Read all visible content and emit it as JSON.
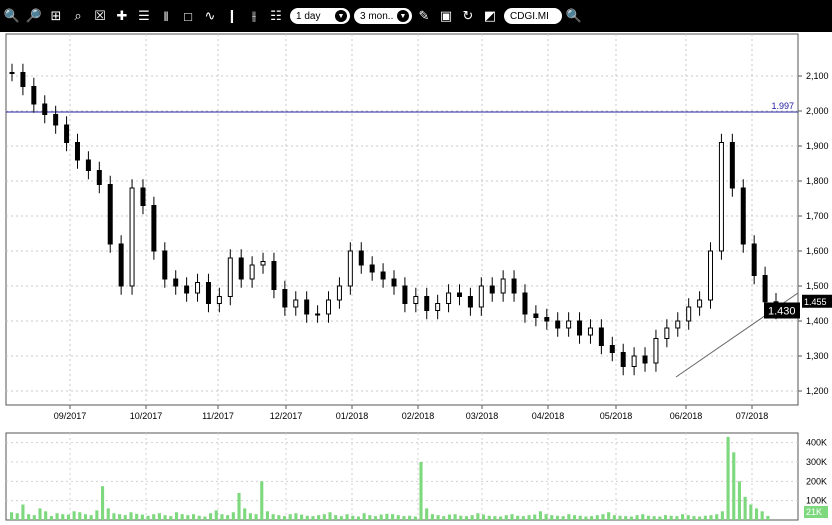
{
  "toolbar": {
    "interval": "1 day",
    "range": "3 mon..",
    "symbol": "CDGI.MI",
    "icons": [
      "zoom-in-icon",
      "zoom-out-icon",
      "zoom-fit-icon",
      "zoom-box-icon",
      "zoom-reset-icon",
      "crosshair-icon",
      "list-icon",
      "bars-icon",
      "rectangle-icon",
      "line-chart-icon",
      "candlestick-icon",
      "ohlc-icon",
      "indicators-icon",
      "interval-dropdown",
      "range-dropdown",
      "draw-icon",
      "save-icon",
      "refresh-icon",
      "color-icon",
      "symbol-field",
      "search-icon"
    ]
  },
  "chart_data": [
    {
      "type": "candlestick",
      "title": "",
      "x_labels": [
        "09/2017",
        "10/2017",
        "11/2017",
        "12/2017",
        "01/2018",
        "02/2018",
        "03/2018",
        "04/2018",
        "05/2018",
        "06/2018",
        "07/2018"
      ],
      "y_ticks": [
        1.2,
        1.3,
        1.4,
        1.5,
        1.6,
        1.7,
        1.8,
        1.9,
        2.0,
        2.1
      ],
      "y_tick_labels": [
        "1,200",
        "1,300",
        "1,400",
        "1,500",
        "1,600",
        "1,700",
        "1,800",
        "1,900",
        "2,000",
        "2,100"
      ],
      "ylim": [
        1.16,
        2.22
      ],
      "grid": true,
      "horizontal_line": {
        "value": 1.997,
        "label": "1.997",
        "color": "#2020a0"
      },
      "trend_line": {
        "from": {
          "date": "2018-06-01",
          "value": 1.24
        },
        "to": {
          "date": "2018-07-31",
          "value": 1.48
        }
      },
      "last_price": {
        "value": 1.43,
        "label": "1.430"
      },
      "previous_price": {
        "value": 1.455,
        "label": "1.455"
      },
      "series": [
        {
          "date": "2017-08-21",
          "value": 2.11
        },
        {
          "date": "2017-08-28",
          "value": 2.07
        },
        {
          "date": "2017-09-04",
          "value": 2.02
        },
        {
          "date": "2017-09-11",
          "value": 1.99
        },
        {
          "date": "2017-09-18",
          "value": 1.96
        },
        {
          "date": "2017-09-25",
          "value": 1.91
        },
        {
          "date": "2017-10-02",
          "value": 1.86
        },
        {
          "date": "2017-10-09",
          "value": 1.83
        },
        {
          "date": "2017-10-16",
          "value": 1.79
        },
        {
          "date": "2017-10-23",
          "value": 1.62
        },
        {
          "date": "2017-10-30",
          "value": 1.5
        },
        {
          "date": "2017-11-06",
          "value": 1.78
        },
        {
          "date": "2017-11-13",
          "value": 1.73
        },
        {
          "date": "2017-11-20",
          "value": 1.6
        },
        {
          "date": "2017-11-27",
          "value": 1.52
        },
        {
          "date": "2017-12-04",
          "value": 1.5
        },
        {
          "date": "2017-12-11",
          "value": 1.48
        },
        {
          "date": "2017-12-18",
          "value": 1.51
        },
        {
          "date": "2017-12-25",
          "value": 1.45
        },
        {
          "date": "2018-01-01",
          "value": 1.47
        },
        {
          "date": "2018-01-08",
          "value": 1.58
        },
        {
          "date": "2018-01-15",
          "value": 1.52
        },
        {
          "date": "2018-01-22",
          "value": 1.56
        },
        {
          "date": "2018-01-29",
          "value": 1.57
        },
        {
          "date": "2018-02-05",
          "value": 1.49
        },
        {
          "date": "2018-02-12",
          "value": 1.44
        },
        {
          "date": "2018-02-19",
          "value": 1.46
        },
        {
          "date": "2018-02-26",
          "value": 1.42
        },
        {
          "date": "2018-03-05",
          "value": 1.42
        },
        {
          "date": "2018-03-12",
          "value": 1.46
        },
        {
          "date": "2018-03-19",
          "value": 1.5
        },
        {
          "date": "2018-03-26",
          "value": 1.6
        },
        {
          "date": "2018-04-02",
          "value": 1.56
        },
        {
          "date": "2018-04-09",
          "value": 1.54
        },
        {
          "date": "2018-04-16",
          "value": 1.52
        },
        {
          "date": "2018-04-23",
          "value": 1.5
        },
        {
          "date": "2018-04-30",
          "value": 1.45
        },
        {
          "date": "2018-05-07",
          "value": 1.47
        },
        {
          "date": "2018-05-14",
          "value": 1.43
        },
        {
          "date": "2018-05-21",
          "value": 1.45
        },
        {
          "date": "2018-05-28",
          "value": 1.48
        },
        {
          "date": "2018-06-04",
          "value": 1.47
        },
        {
          "date": "2018-06-11",
          "value": 1.44
        },
        {
          "date": "2018-06-18",
          "value": 1.5
        },
        {
          "date": "2018-06-25",
          "value": 1.48
        },
        {
          "date": "2018-07-02",
          "value": 1.52
        },
        {
          "date": "2018-07-09",
          "value": 1.48
        },
        {
          "date": "2018-07-16",
          "value": 1.42
        },
        {
          "date": "2018-07-23",
          "value": 1.41
        },
        {
          "date": "2018-07-30",
          "value": 1.4
        },
        {
          "date": "2018-08-06",
          "value": 1.38
        },
        {
          "date": "2018-08-13",
          "value": 1.4
        },
        {
          "date": "2018-08-20",
          "value": 1.36
        },
        {
          "date": "2018-08-27",
          "value": 1.38
        },
        {
          "date": "2018-09-03",
          "value": 1.33
        },
        {
          "date": "2018-09-10",
          "value": 1.31
        },
        {
          "date": "2018-09-17",
          "value": 1.27
        },
        {
          "date": "2018-09-24",
          "value": 1.3
        },
        {
          "date": "2018-10-01",
          "value": 1.28
        },
        {
          "date": "2018-10-08",
          "value": 1.35
        },
        {
          "date": "2018-10-15",
          "value": 1.38
        },
        {
          "date": "2018-10-22",
          "value": 1.4
        },
        {
          "date": "2018-10-29",
          "value": 1.44
        },
        {
          "date": "2018-11-05",
          "value": 1.46
        },
        {
          "date": "2018-11-12",
          "value": 1.6
        },
        {
          "date": "2018-11-19",
          "value": 1.91
        },
        {
          "date": "2018-11-26",
          "value": 1.78
        },
        {
          "date": "2018-12-03",
          "value": 1.62
        },
        {
          "date": "2018-12-10",
          "value": 1.53
        },
        {
          "date": "2018-12-17",
          "value": 1.455
        },
        {
          "date": "2018-12-24",
          "value": 1.43
        }
      ]
    },
    {
      "type": "bar",
      "title": "Volume",
      "y_tick_labels": [
        "100K",
        "200K",
        "300K",
        "400K"
      ],
      "y_ticks": [
        100000,
        200000,
        300000,
        400000
      ],
      "last_volume_label": "21K",
      "ylim": [
        0,
        450000
      ],
      "color": "#7ed87e",
      "values": [
        40000,
        35000,
        80000,
        30000,
        25000,
        60000,
        45000,
        20000,
        35000,
        30000,
        28000,
        45000,
        40000,
        30000,
        25000,
        50000,
        175000,
        60000,
        35000,
        30000,
        25000,
        40000,
        32000,
        28000,
        22000,
        30000,
        35000,
        25000,
        20000,
        40000,
        30000,
        25000,
        30000,
        22000,
        18000,
        35000,
        50000,
        30000,
        25000,
        40000,
        140000,
        60000,
        35000,
        30000,
        200000,
        45000,
        30000,
        25000,
        20000,
        30000,
        35000,
        28000,
        22000,
        20000,
        25000,
        30000,
        40000,
        25000,
        20000,
        30000,
        22000,
        18000,
        35000,
        25000,
        20000,
        28000,
        32000,
        30000,
        25000,
        20000,
        22000,
        18000,
        300000,
        60000,
        30000,
        25000,
        20000,
        28000,
        30000,
        22000,
        20000,
        25000,
        35000,
        28000,
        22000,
        20000,
        18000,
        25000,
        30000,
        22000,
        20000,
        25000,
        28000,
        45000,
        30000,
        25000,
        22000,
        20000,
        30000,
        25000,
        22000,
        18000,
        20000,
        25000,
        30000,
        40000,
        25000,
        22000,
        20000,
        18000,
        25000,
        30000,
        22000,
        20000,
        18000,
        25000,
        22000,
        20000,
        30000,
        25000,
        20000,
        18000,
        22000,
        25000,
        30000,
        45000,
        430000,
        350000,
        200000,
        120000,
        80000,
        60000,
        45000,
        21000
      ]
    }
  ]
}
